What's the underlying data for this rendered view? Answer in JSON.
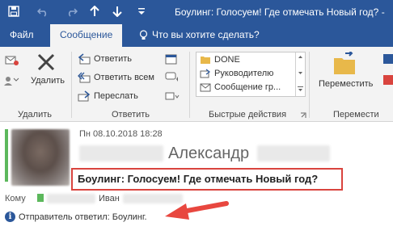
{
  "window": {
    "title": "Боулинг: Голосуем! Где отмечать Новый год? -"
  },
  "tabs": [
    {
      "label": "Файл"
    },
    {
      "label": "Сообщение"
    },
    {
      "label": "Что вы хотите сделать?"
    }
  ],
  "ribbon": {
    "delete_group": {
      "delete_label": "Удалить",
      "group_label": "Удалить"
    },
    "respond_group": {
      "reply_label": "Ответить",
      "reply_all_label": "Ответить всем",
      "forward_label": "Переслать",
      "group_label": "Ответить"
    },
    "quick_steps": {
      "items": [
        {
          "label": "DONE"
        },
        {
          "label": "Руководителю"
        },
        {
          "label": "Сообщение гр..."
        }
      ],
      "group_label": "Быстрые действия"
    },
    "move_group": {
      "move_label": "Переместить",
      "group_label": "Перемести"
    }
  },
  "message": {
    "date": "Пн 08.10.2018 18:28",
    "sender_name": "Александр",
    "subject": "Боулинг: Голосуем! Где отмечать Новый год?",
    "to_label": "Кому",
    "to_name": "Иван",
    "info_text": "Отправитель ответил: Боулинг."
  },
  "colors": {
    "accent": "#2b579a",
    "highlight_box": "#d9443e",
    "arrow": "#e8473f",
    "presence": "#5cb85c"
  }
}
